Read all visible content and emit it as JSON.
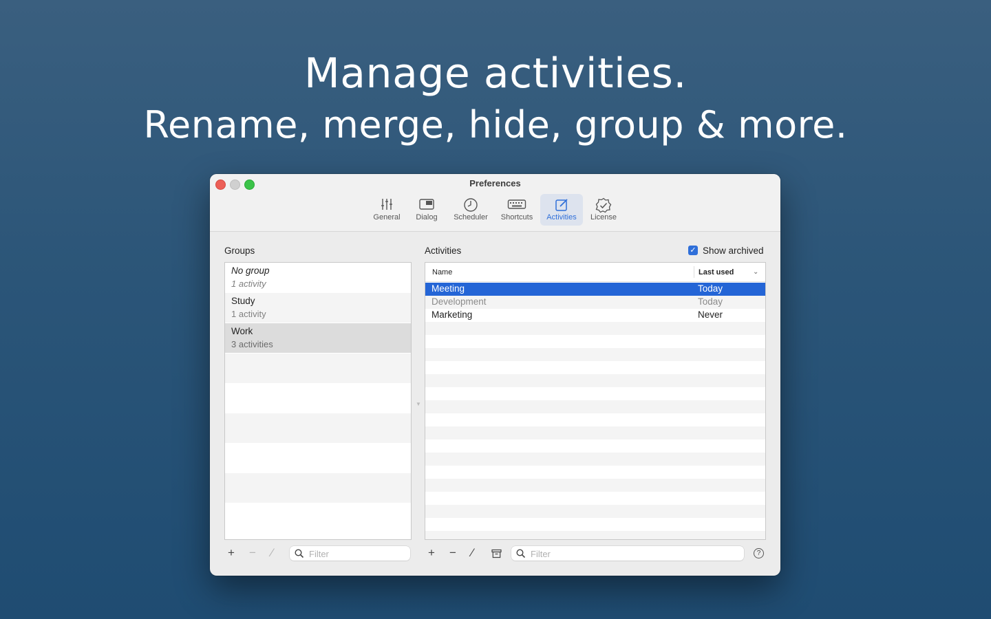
{
  "headline": {
    "line1": "Manage activities.",
    "line2": "Rename, merge, hide, group & more."
  },
  "window": {
    "title": "Preferences"
  },
  "toolbar": {
    "tabs": [
      {
        "label": "General",
        "icon": "sliders-icon"
      },
      {
        "label": "Dialog",
        "icon": "window-icon"
      },
      {
        "label": "Scheduler",
        "icon": "clock-icon"
      },
      {
        "label": "Shortcuts",
        "icon": "keyboard-icon"
      },
      {
        "label": "Activities",
        "icon": "edit-icon",
        "active": true
      },
      {
        "label": "License",
        "icon": "badge-check-icon"
      }
    ]
  },
  "groups": {
    "title": "Groups",
    "items": [
      {
        "name": "No group",
        "count": "1 activity",
        "italic": true
      },
      {
        "name": "Study",
        "count": "1 activity"
      },
      {
        "name": "Work",
        "count": "3 activities",
        "selected": true
      }
    ],
    "filter_placeholder": "Filter",
    "buttons": {
      "add": "+",
      "remove": "−",
      "edit": "⁄"
    }
  },
  "activities": {
    "title": "Activities",
    "show_archived_label": "Show archived",
    "show_archived_checked": true,
    "columns": {
      "name": "Name",
      "last_used": "Last used"
    },
    "rows": [
      {
        "name": "Meeting",
        "last_used": "Today",
        "state": "selected"
      },
      {
        "name": "Development",
        "last_used": "Today",
        "state": "archived"
      },
      {
        "name": "Marketing",
        "last_used": "Never",
        "state": "normal"
      }
    ],
    "filter_placeholder": "Filter",
    "buttons": {
      "add": "+",
      "remove": "−",
      "edit": "⁄",
      "archive": "archive-icon",
      "help": "?"
    }
  },
  "colors": {
    "accent": "#2465d6",
    "selection_gray": "#dcdcdc",
    "background": "#2b5578"
  }
}
